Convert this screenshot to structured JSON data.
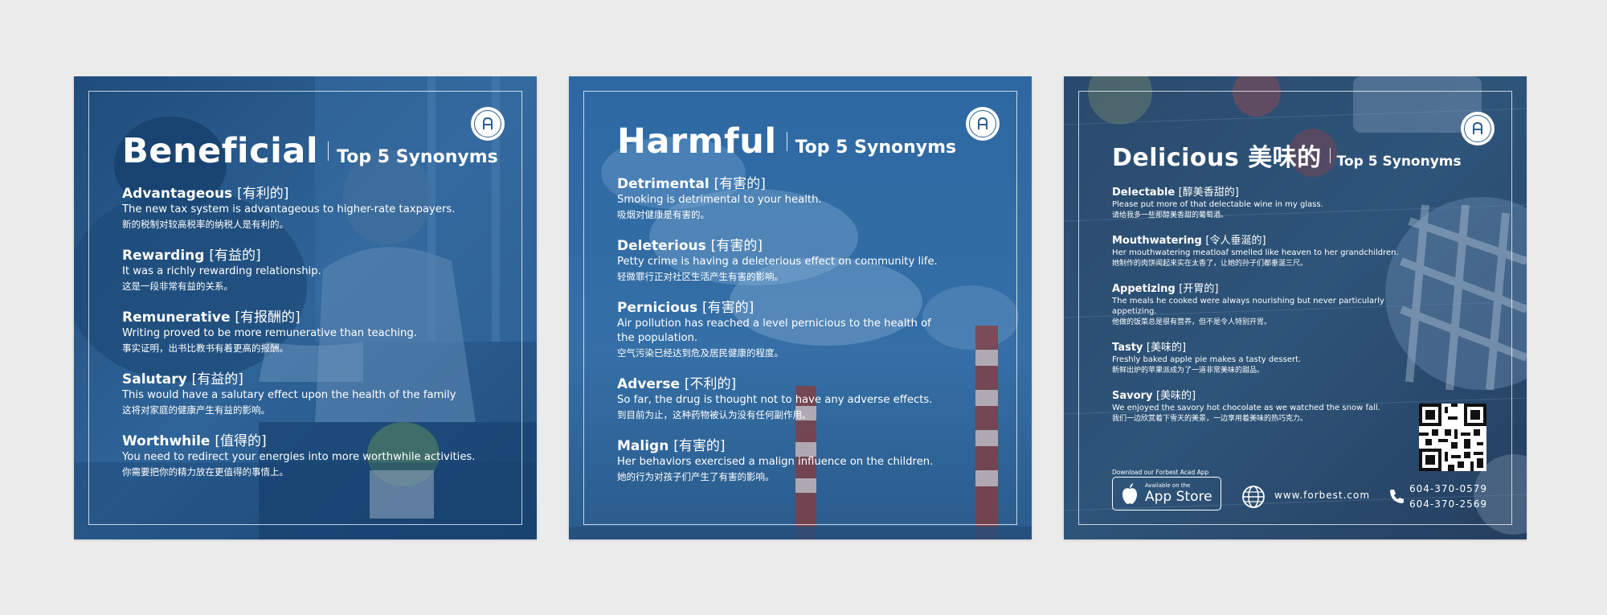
{
  "colors": {
    "page_bg": "#ebebeb",
    "card_blue": "#2b5d8e",
    "text": "#ffffff",
    "logo_ring": "#2a5f92"
  },
  "cards": [
    {
      "title": "Beneficial",
      "subtitle": "Top 5 Synonyms",
      "logo_icon": "forbest-academy-logo-icon",
      "entries": [
        {
          "word": "Advantageous",
          "cn": "[有利的]",
          "en": "The new tax system is advantageous to higher-rate taxpayers.",
          "zh": "新的税制对较高税率的纳税人是有利的。"
        },
        {
          "word": "Rewarding",
          "cn": "[有益的]",
          "en": "It was a richly rewarding relationship.",
          "zh": "这是一段非常有益的关系。"
        },
        {
          "word": "Remunerative",
          "cn": "[有报酬的]",
          "en": "Writing proved to be more remunerative than teaching.",
          "zh": "事实证明，出书比教书有着更高的报酬。"
        },
        {
          "word": "Salutary",
          "cn": "[有益的]",
          "en": "This would have a salutary effect upon the health of the family",
          "zh": "这将对家庭的健康产生有益的影响。"
        },
        {
          "word": "Worthwhile",
          "cn": "[值得的]",
          "en": "You need to redirect your energies into more worthwhile activities.",
          "zh": "你需要把你的精力放在更值得的事情上。"
        }
      ]
    },
    {
      "title": "Harmful",
      "subtitle": "Top 5 Synonyms",
      "logo_icon": "forbest-academy-logo-icon",
      "entries": [
        {
          "word": "Detrimental",
          "cn": "[有害的]",
          "en": "Smoking is detrimental to your health.",
          "zh": "吸烟对健康是有害的。"
        },
        {
          "word": "Deleterious",
          "cn": "[有害的]",
          "en": "Petty crime is having a deleterious effect on community life.",
          "zh": "轻微罪行正对社区生活产生有害的影响。"
        },
        {
          "word": "Pernicious",
          "cn": "[有害的]",
          "en": "Air pollution has reached a level pernicious to the health of the population.",
          "zh": "空气污染已经达到危及居民健康的程度。"
        },
        {
          "word": "Adverse",
          "cn": "[不利的]",
          "en": "So far, the drug is thought not to have any adverse effects.",
          "zh": "到目前为止，这种药物被认为没有任何副作用。"
        },
        {
          "word": "Malign",
          "cn": "[有害的]",
          "en": "Her behaviors exercised a malign influence on the children.",
          "zh": "她的行为对孩子们产生了有害的影响。"
        }
      ]
    },
    {
      "title": "Delicious 美味的",
      "subtitle": "Top 5 Synonyms",
      "logo_icon": "forbest-academy-logo-icon",
      "entries": [
        {
          "word": "Delectable",
          "cn": "[醇美香甜的]",
          "en": "Please put more of that delectable wine in my glass.",
          "zh": "请给我多一些那醇美香甜的葡萄酒。"
        },
        {
          "word": "Mouthwatering",
          "cn": "[令人垂涎的]",
          "en": "Her mouthwatering meatloaf smelled like heaven to her grandchildren.",
          "zh": "她制作的肉饼闻起来实在太香了，让她的孙子们都垂涎三尺。"
        },
        {
          "word": "Appetizing",
          "cn": "[开胃的]",
          "en": "The meals he cooked were always nourishing but never particularly appetizing.",
          "zh": "他做的饭菜总是很有营养，但不是令人特别开胃。"
        },
        {
          "word": "Tasty",
          "cn": "[美味的]",
          "en": "Freshly baked apple pie makes a tasty dessert.",
          "zh": "新鲜出炉的苹果派成为了一道非常美味的甜品。"
        },
        {
          "word": "Savory",
          "cn": "[美味的]",
          "en": "We enjoyed the savory hot chocolate as we watched the snow fall.",
          "zh": "我们一边欣赏着下雪天的美景，一边享用着美味的热巧克力。"
        }
      ],
      "footer": {
        "download_text": "Download our Forbest Acad App",
        "store_small": "Available on the",
        "store_big": "App Store",
        "website": "www.forbest.com",
        "phone1": "604-370-0579",
        "phone2": "604-370-2569"
      }
    }
  ]
}
